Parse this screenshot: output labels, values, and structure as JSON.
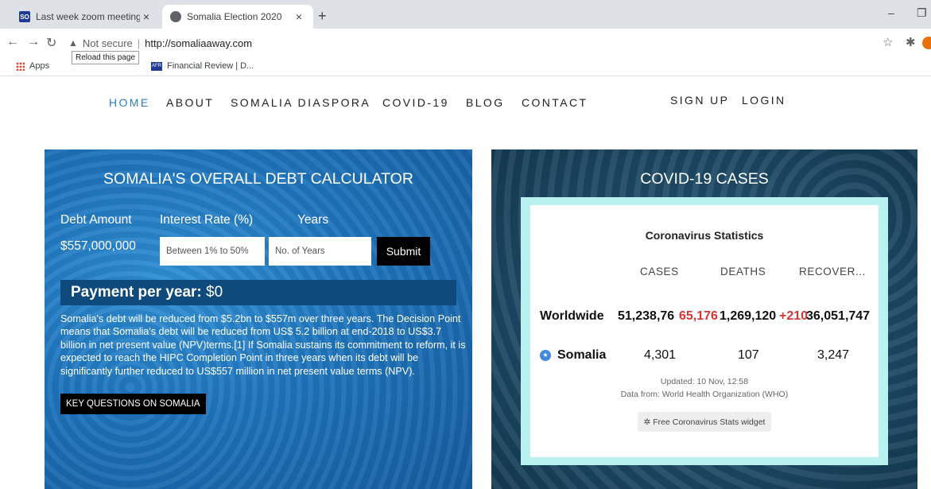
{
  "browser": {
    "tabs": [
      {
        "title": "Last week zoom meeting - ISOC...",
        "close": "×"
      },
      {
        "title": "Somalia Election 2020",
        "close": "×"
      }
    ],
    "new_tab": "+",
    "window_controls": {
      "minimize": "–",
      "restore": "❐"
    },
    "address": {
      "security": "Not secure",
      "url": "http://somaliaaway.com"
    },
    "tooltip": "Reload this page",
    "bookmarks": [
      {
        "label": "Apps"
      },
      {
        "label": "Financial Review | D...",
        "icon_text": "AFR"
      }
    ],
    "icons": {
      "back": "back-arrow-icon",
      "forward": "forward-arrow-icon",
      "reload": "reload-icon",
      "star": "star-icon",
      "extensions": "puzzle-icon"
    }
  },
  "nav": {
    "items": [
      "HOME",
      "ABOUT",
      "SOMALIA DIASPORA",
      "COVID-19",
      "BLOG",
      "CONTACT"
    ],
    "account": [
      "SIGN UP",
      "LOGIN"
    ],
    "active_color": "#2d7fb8"
  },
  "debt": {
    "heading": "SOMALIA'S OVERALL DEBT CALCULATOR",
    "labels": {
      "amount": "Debt Amount",
      "rate": "Interest Rate (%)",
      "years": "Years"
    },
    "amount_value": "$557,000,000",
    "rate_placeholder": "Between 1% to 50%",
    "years_placeholder": "No. of Years",
    "submit_label": "Submit",
    "payment_label": "Payment per year:",
    "payment_value": " $0",
    "paragraph": "Somalia's debt will be reduced from $5.2bn to $557m over three years. The Decision Point means that Somalia's debt will be reduced from US$ 5.2 billion at end-2018 to US$3.7 billion in net present value (NPV)terms.[1] If Somalia sustains its commitment to reform, it is expected to reach the HIPC Completion Point in three years when its debt will be significantly further reduced to US$557 million in net present value terms (NPV).",
    "key_questions_label": "KEY QUESTIONS ON SOMALIA"
  },
  "covid": {
    "heading": "COVID-19 CASES",
    "widget_title": "Coronavirus Statistics",
    "columns": [
      "CASES",
      "DEATHS",
      "RECOVER..."
    ],
    "worldwide": {
      "label": "Worldwide",
      "cases": "51,238,76",
      "cases_delta": "65,176",
      "deaths": "1,269,120",
      "deaths_delta": "+210",
      "recovered": "36,051,747"
    },
    "somalia": {
      "label": "Somalia",
      "cases": "4,301",
      "deaths": "107",
      "recovered": "3,247"
    },
    "updated": "Updated: 10 Nov, 12:58",
    "source": "Data from: World Health Organization (WHO)",
    "widget_button": "Free Coronavirus Stats widget",
    "delta_color": "#d73434"
  }
}
